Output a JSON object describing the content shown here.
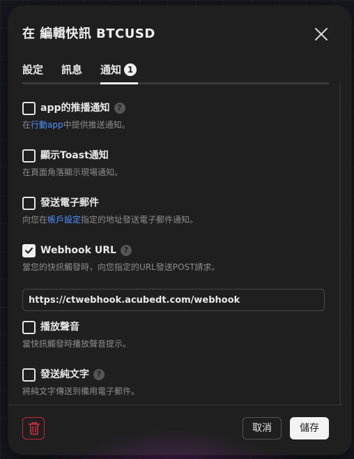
{
  "dialog": {
    "title": "在 編輯快訊 BTCUSD",
    "close_icon": "close-icon"
  },
  "tabs": [
    {
      "label": "設定"
    },
    {
      "label": "訊息"
    },
    {
      "label": "通知",
      "badge": "1",
      "active": true
    }
  ],
  "notifications": {
    "app_push": {
      "label": "app的推播通知",
      "checked": false,
      "help": "?",
      "desc_before": "在",
      "desc_link": "行動app",
      "desc_after": "中提供推送通知。"
    },
    "toast": {
      "label": "顯示Toast通知",
      "checked": false,
      "desc": "在頁面角落顯示現場通知。"
    },
    "email": {
      "label": "發送電子郵件",
      "checked": false,
      "desc_before": "向您在",
      "desc_link": "帳戶設定",
      "desc_after": "指定的地址發送電子郵件通知。"
    },
    "webhook": {
      "label": "Webhook URL",
      "checked": true,
      "help": "?",
      "desc": "當您的快訊觸發時，向您指定的URL發送POST請求。",
      "url_value": "https://ctwebhook.acubedt.com/webhook"
    },
    "sound": {
      "label": "播放聲音",
      "checked": false,
      "desc": "當快訊觸發時播放聲音提示。"
    },
    "plain_text": {
      "label": "發送純文字",
      "checked": false,
      "help": "?",
      "desc": "將純文字傳送到備用電子郵件。"
    }
  },
  "footer": {
    "delete_icon": "trash-icon",
    "cancel_label": "取消",
    "save_label": "儲存"
  },
  "colors": {
    "link": "#4f93ff",
    "delete_border": "#c0273e",
    "dialog_bg": "#1f1f1f"
  }
}
